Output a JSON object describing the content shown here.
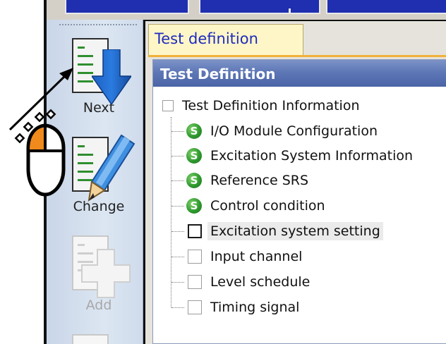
{
  "colors": {
    "toolbar_blue": "#1f2fb0",
    "tab_text": "#1e2bbd",
    "tab_bg": "#fff6c8",
    "header_blue": "#5b75b5",
    "status_green": "#2e9a2e",
    "mouse_button_accent": "#f08a1c"
  },
  "toolbar": {
    "next_label": "Next",
    "change_label": "Change",
    "add_label": "Add",
    "next_icon": "down-arrow-icon",
    "change_icon": "pencil-icon",
    "add_icon": "plus-icon"
  },
  "tab": {
    "label": "Test definition"
  },
  "panel": {
    "title": "Test Definition"
  },
  "tree": {
    "root": {
      "label": "Test Definition Information",
      "checked": false
    },
    "items": [
      {
        "label": "I/O Module Configuration",
        "status": "S",
        "state": "set"
      },
      {
        "label": "Excitation System Information",
        "status": "S",
        "state": "set"
      },
      {
        "label": "Reference SRS",
        "status": "S",
        "state": "set"
      },
      {
        "label": "Control condition",
        "status": "S",
        "state": "set"
      },
      {
        "label": "Excitation system setting",
        "status": "",
        "state": "selected"
      },
      {
        "label": "Input channel",
        "status": "",
        "state": "unset"
      },
      {
        "label": "Level schedule",
        "status": "",
        "state": "unset"
      },
      {
        "label": "Timing signal",
        "status": "",
        "state": "unset"
      }
    ]
  },
  "annotation": {
    "cursor_icon": "mouse-left-click-icon",
    "pointer_icon": "arrow-pointer-icon"
  }
}
